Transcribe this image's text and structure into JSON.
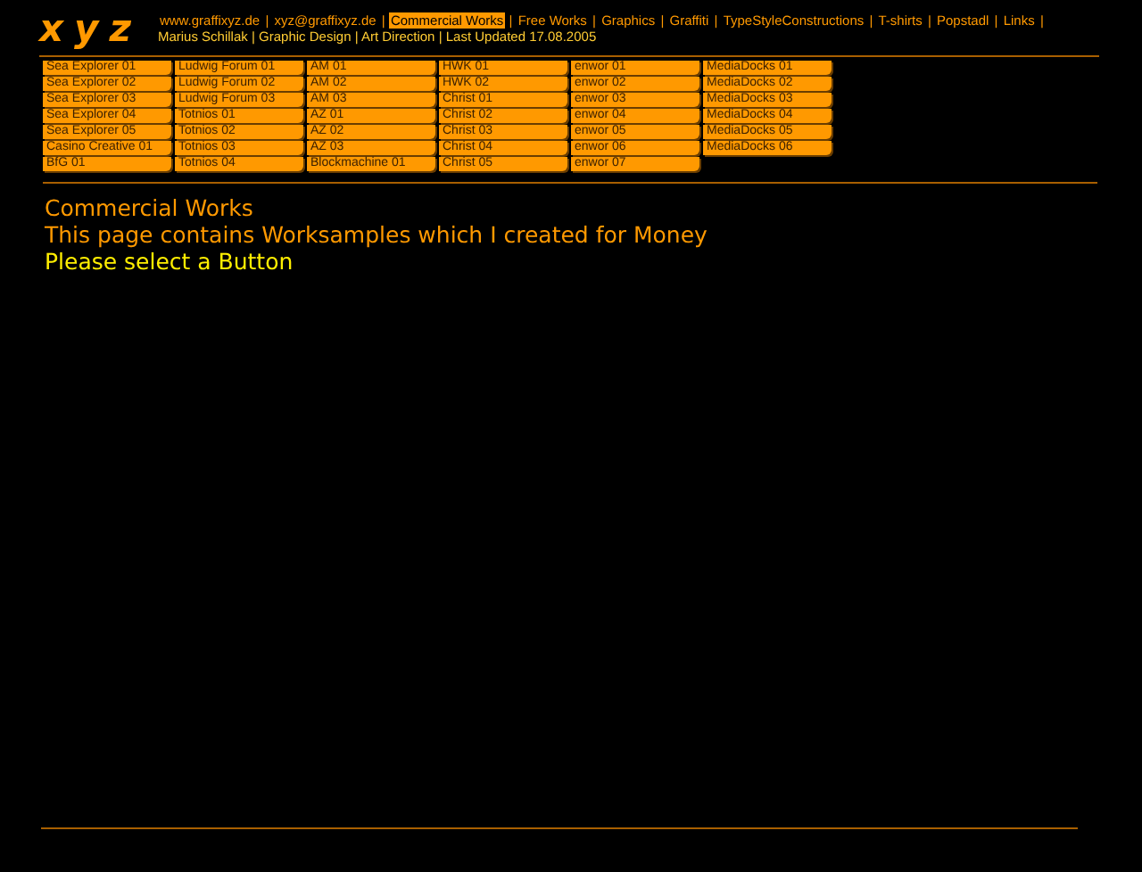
{
  "logo": {
    "text": "xyz"
  },
  "nav": {
    "separator": "|",
    "links": [
      {
        "label": "www.graffixyz.de",
        "selected": false
      },
      {
        "label": "xyz@graffixyz.de",
        "selected": false
      },
      {
        "label": "Commercial Works",
        "selected": true
      },
      {
        "label": "Free Works",
        "selected": false
      },
      {
        "label": "Graphics",
        "selected": false
      },
      {
        "label": "Graffiti",
        "selected": false
      },
      {
        "label": "TypeStyleConstructions",
        "selected": false
      },
      {
        "label": "T-shirts",
        "selected": false
      },
      {
        "label": "Popstadl",
        "selected": false
      },
      {
        "label": "Links",
        "selected": false
      }
    ],
    "info": [
      "Marius Schillak",
      "Graphic Design",
      "Art Direction",
      "Last Updated 17.08.2005"
    ]
  },
  "work_buttons": [
    [
      "Sea Explorer 01",
      "Sea Explorer 02",
      "Sea Explorer 03",
      "Sea Explorer 04",
      "Sea Explorer 05",
      "Casino Creative 01",
      "BfG 01"
    ],
    [
      "Ludwig Forum 01",
      "Ludwig Forum 02",
      "Ludwig Forum 03",
      "Totnios 01",
      "Totnios 02",
      "Totnios 03",
      "Totnios 04"
    ],
    [
      "AM 01",
      "AM 02",
      "AM 03",
      "AZ 01",
      "AZ 02",
      "AZ 03",
      "Blockmachine 01"
    ],
    [
      "HWK 01",
      "HWK 02",
      "Christ 01",
      "Christ 02",
      "Christ 03",
      "Christ 04",
      "Christ 05"
    ],
    [
      "enwor 01",
      "enwor 02",
      "enwor 03",
      "enwor 04",
      "enwor 05",
      "enwor 06",
      "enwor 07"
    ],
    [
      "MediaDocks 01",
      "MediaDocks 02",
      "MediaDocks 03",
      "MediaDocks 04",
      "MediaDocks 05",
      "MediaDocks 06"
    ]
  ],
  "content": {
    "title": "Commercial Works",
    "description": "This page contains Worksamples which I created for Money",
    "prompt": "Please select a Button"
  }
}
